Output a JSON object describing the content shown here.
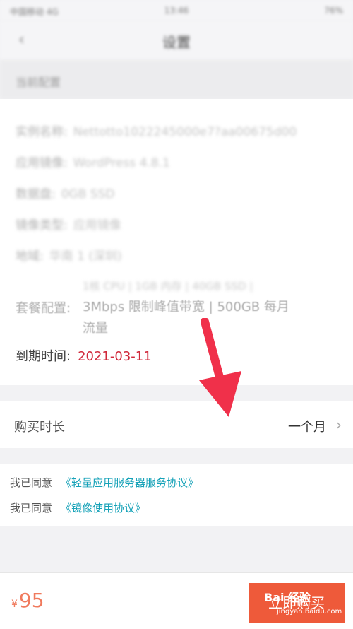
{
  "status_bar": {
    "carrier": "中国移动 4G",
    "time": "13:46",
    "battery": "76%"
  },
  "nav": {
    "back_glyph": "‹",
    "title": "设置"
  },
  "section": {
    "title": "当前配置"
  },
  "info": {
    "rows": [
      {
        "label": "实例名称:",
        "value": "Nettotto1022245000e7?aa00675d00"
      },
      {
        "label": "应用镜像:",
        "value": "WordPress 4.8.1"
      },
      {
        "label": "数据盘:",
        "value": "0GB SSD"
      },
      {
        "label": "镜像类型:",
        "value": "应用镜像"
      },
      {
        "label": "地域:",
        "value": "华南 1 (深圳)"
      }
    ],
    "plan_label": "套餐配置:",
    "plan_line1": "1核 CPU | 1GB 内存 | 40GB SSD |",
    "plan_line2": "3Mbps 限制峰值带宽 | 500GB 每月",
    "plan_line3": "流量",
    "expiry_label": "到期时间:",
    "expiry_value": "2021-03-11"
  },
  "duration": {
    "label": "购买时长",
    "value": "一个月"
  },
  "agreements": [
    {
      "prefix": "我已同意",
      "link": "《轻量应用服务器服务协议》"
    },
    {
      "prefix": "我已同意",
      "link": "《镜像使用协议》"
    }
  ],
  "bottom": {
    "currency": "¥",
    "price": "95",
    "buy_label": "立即购买"
  },
  "watermark": {
    "brand": "Bai 经验",
    "url": "jingyan.baidu.com"
  },
  "colors": {
    "accent_red": "#d0283a",
    "link_teal": "#16a2b8",
    "buy_button": "#ee5a3a",
    "arrow": "#f0304a"
  }
}
